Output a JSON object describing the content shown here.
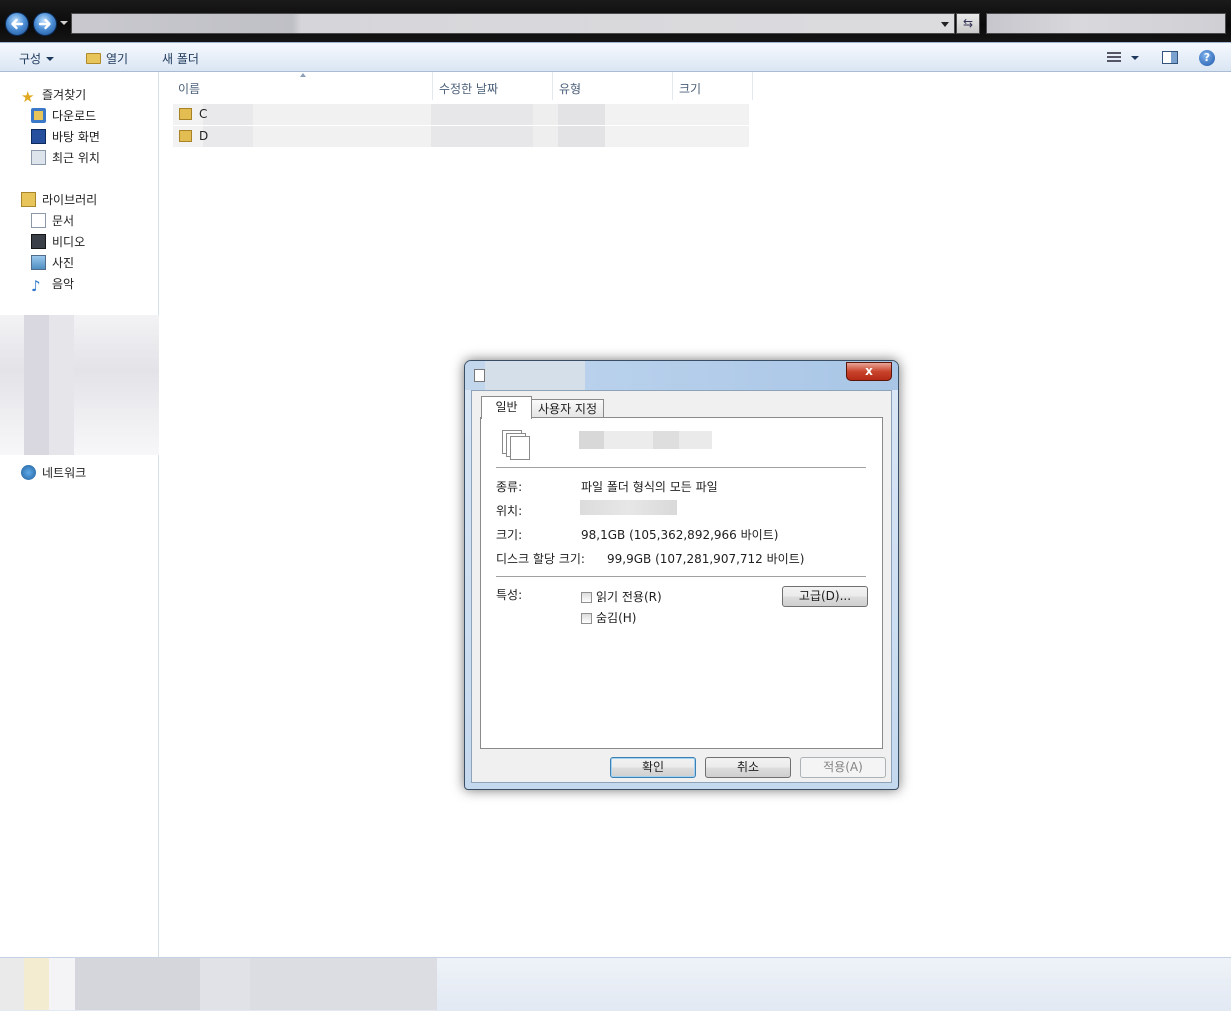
{
  "toolbar": {
    "organize": "구성",
    "open": "열기",
    "new_folder": "새 폴더"
  },
  "nav": {
    "favorites": "즐겨찾기",
    "downloads": "다운로드",
    "desktop": "바탕 화면",
    "recent": "최근 위치",
    "libraries": "라이브러리",
    "documents": "문서",
    "videos": "비디오",
    "pictures": "사진",
    "music": "음악",
    "network": "네트워크"
  },
  "columns": {
    "name": "이름",
    "modified": "수정한 날짜",
    "type": "유형",
    "size": "크기"
  },
  "files": [
    {
      "name": "C"
    },
    {
      "name": "D"
    }
  ],
  "dialog": {
    "close": "x",
    "tabs": {
      "general": "일반",
      "custom": "사용자 지정"
    },
    "type_label": "종류:",
    "type_value": "파일 폴더 형식의 모든 파일",
    "location_label": "위치:",
    "size_label": "크기:",
    "size_value": "98,1GB (105,362,892,966 바이트)",
    "size_on_disk_label": "디스크 할당 크기:",
    "size_on_disk_value": "99,9GB (107,281,907,712 바이트)",
    "attributes_label": "특성:",
    "readonly": "읽기 전용(R)",
    "hidden": "숨김(H)",
    "advanced": "고급(D)...",
    "ok": "확인",
    "cancel": "취소",
    "apply": "적용(A)"
  },
  "colors": {
    "command_bar_text": "#1e395b",
    "window_frame": "#c4d8ee",
    "close_button": "#c9442c"
  }
}
